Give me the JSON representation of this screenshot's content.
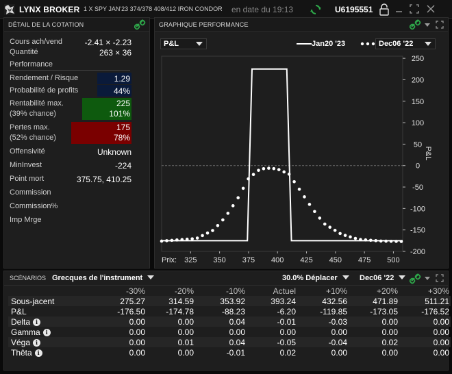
{
  "titlebar": {
    "brand": "LYNX BROKER",
    "instrument": "1 X SPY JAN'23 374/378 408/412 IRON CONDOR",
    "date_text": "en date du 19:13",
    "account": "U6195551"
  },
  "quote_panel": {
    "title": "DÉTAIL DE LA COTATION",
    "rows": [
      {
        "label": "Cours ach/vend",
        "value": "-2.41 × -2.23"
      },
      {
        "label": "Quantité",
        "value": "263 × 36"
      }
    ],
    "section": "Performance",
    "risk_label": "Rendement / Risque",
    "risk_value": "1.29",
    "prob_label": "Probabilité de profits",
    "prob_value": "44%",
    "maxprofit_label1": "Rentabilité max.",
    "maxprofit_label2": "(39% chance)",
    "maxprofit_value1": "225",
    "maxprofit_value2": "101%",
    "maxloss_label1": "Pertes max.",
    "maxloss_label2": "(52% chance)",
    "maxloss_value1": "175",
    "maxloss_value2": "78%",
    "others": [
      {
        "label": "Offensivité",
        "value": "Unknown"
      },
      {
        "label": "MinInvest",
        "value": "-224"
      },
      {
        "label": "Point mort",
        "value": "375.75, 410.25"
      },
      {
        "label": "Commission",
        "value": ""
      },
      {
        "label": "Commission%",
        "value": ""
      },
      {
        "label": "Imp Mrge",
        "value": ""
      }
    ],
    "colors": {
      "profit_box": "#0e5a0e",
      "loss_box": "#7a0000",
      "risk_box": "#0a1a3a"
    }
  },
  "chart_panel": {
    "title": "GRAPHIQUE PERFORMANCE",
    "metric_select": "P&L",
    "series1_label": "Jan20 '23",
    "series2_select": "Dec06 '22",
    "x_prefix": "Prix:",
    "y_label": "P&L"
  },
  "chart_data": {
    "type": "line",
    "title": "",
    "xlabel": "Prix:",
    "ylabel": "P&L",
    "xlim": [
      300,
      508
    ],
    "ylim": [
      -200,
      255
    ],
    "x_ticks": [
      325,
      350,
      375,
      400,
      425,
      450,
      475,
      500
    ],
    "y_ticks": [
      250,
      200,
      150,
      100,
      50,
      0,
      -50,
      -100,
      -150,
      -200
    ],
    "series": [
      {
        "name": "Jan20 '23",
        "style": "solid",
        "x": [
          300,
          374,
          378,
          408,
          412,
          508
        ],
        "y": [
          -175,
          -175,
          225,
          225,
          -175,
          -175
        ]
      },
      {
        "name": "Dec06 '22",
        "style": "dotted",
        "x": [
          300,
          330,
          345,
          355,
          365,
          375,
          385,
          393,
          400,
          410,
          420,
          430,
          440,
          455,
          470,
          490,
          508
        ],
        "y": [
          -176,
          -170,
          -150,
          -120,
          -80,
          -30,
          -8,
          -6,
          -8,
          -20,
          -60,
          -100,
          -135,
          -160,
          -172,
          -176,
          -177
        ]
      }
    ]
  },
  "scenarios": {
    "title": "SCÉNARIOS",
    "greeks_select": "Grecques de l'instrument",
    "shift_select": "30.0% Déplacer",
    "date_select": "Dec06 '22",
    "columns": [
      "-30%",
      "-20%",
      "-10%",
      "Actuel",
      "+10%",
      "+20%",
      "+30%"
    ],
    "rows": [
      {
        "label": "Sous-jacent",
        "info": false,
        "values": [
          "275.27",
          "314.59",
          "353.92",
          "393.24",
          "432.56",
          "471.89",
          "511.21"
        ]
      },
      {
        "label": "P&L",
        "info": false,
        "values": [
          "-176.50",
          "-174.78",
          "-88.23",
          "-6.20",
          "-119.85",
          "-173.05",
          "-176.52"
        ]
      },
      {
        "label": "Delta",
        "info": true,
        "values": [
          "0.00",
          "0.00",
          "0.04",
          "-0.01",
          "-0.03",
          "0.00",
          "0.00"
        ]
      },
      {
        "label": "Gamma",
        "info": true,
        "values": [
          "0.00",
          "0.00",
          "0.00",
          "0.00",
          "0.00",
          "0.00",
          "0.00"
        ]
      },
      {
        "label": "Véga",
        "info": true,
        "values": [
          "0.00",
          "0.01",
          "0.04",
          "-0.05",
          "-0.04",
          "0.02",
          "0.00"
        ]
      },
      {
        "label": "Thêta",
        "info": true,
        "values": [
          "0.00",
          "0.00",
          "-0.01",
          "0.02",
          "0.00",
          "0.00",
          "0.00"
        ]
      }
    ]
  }
}
